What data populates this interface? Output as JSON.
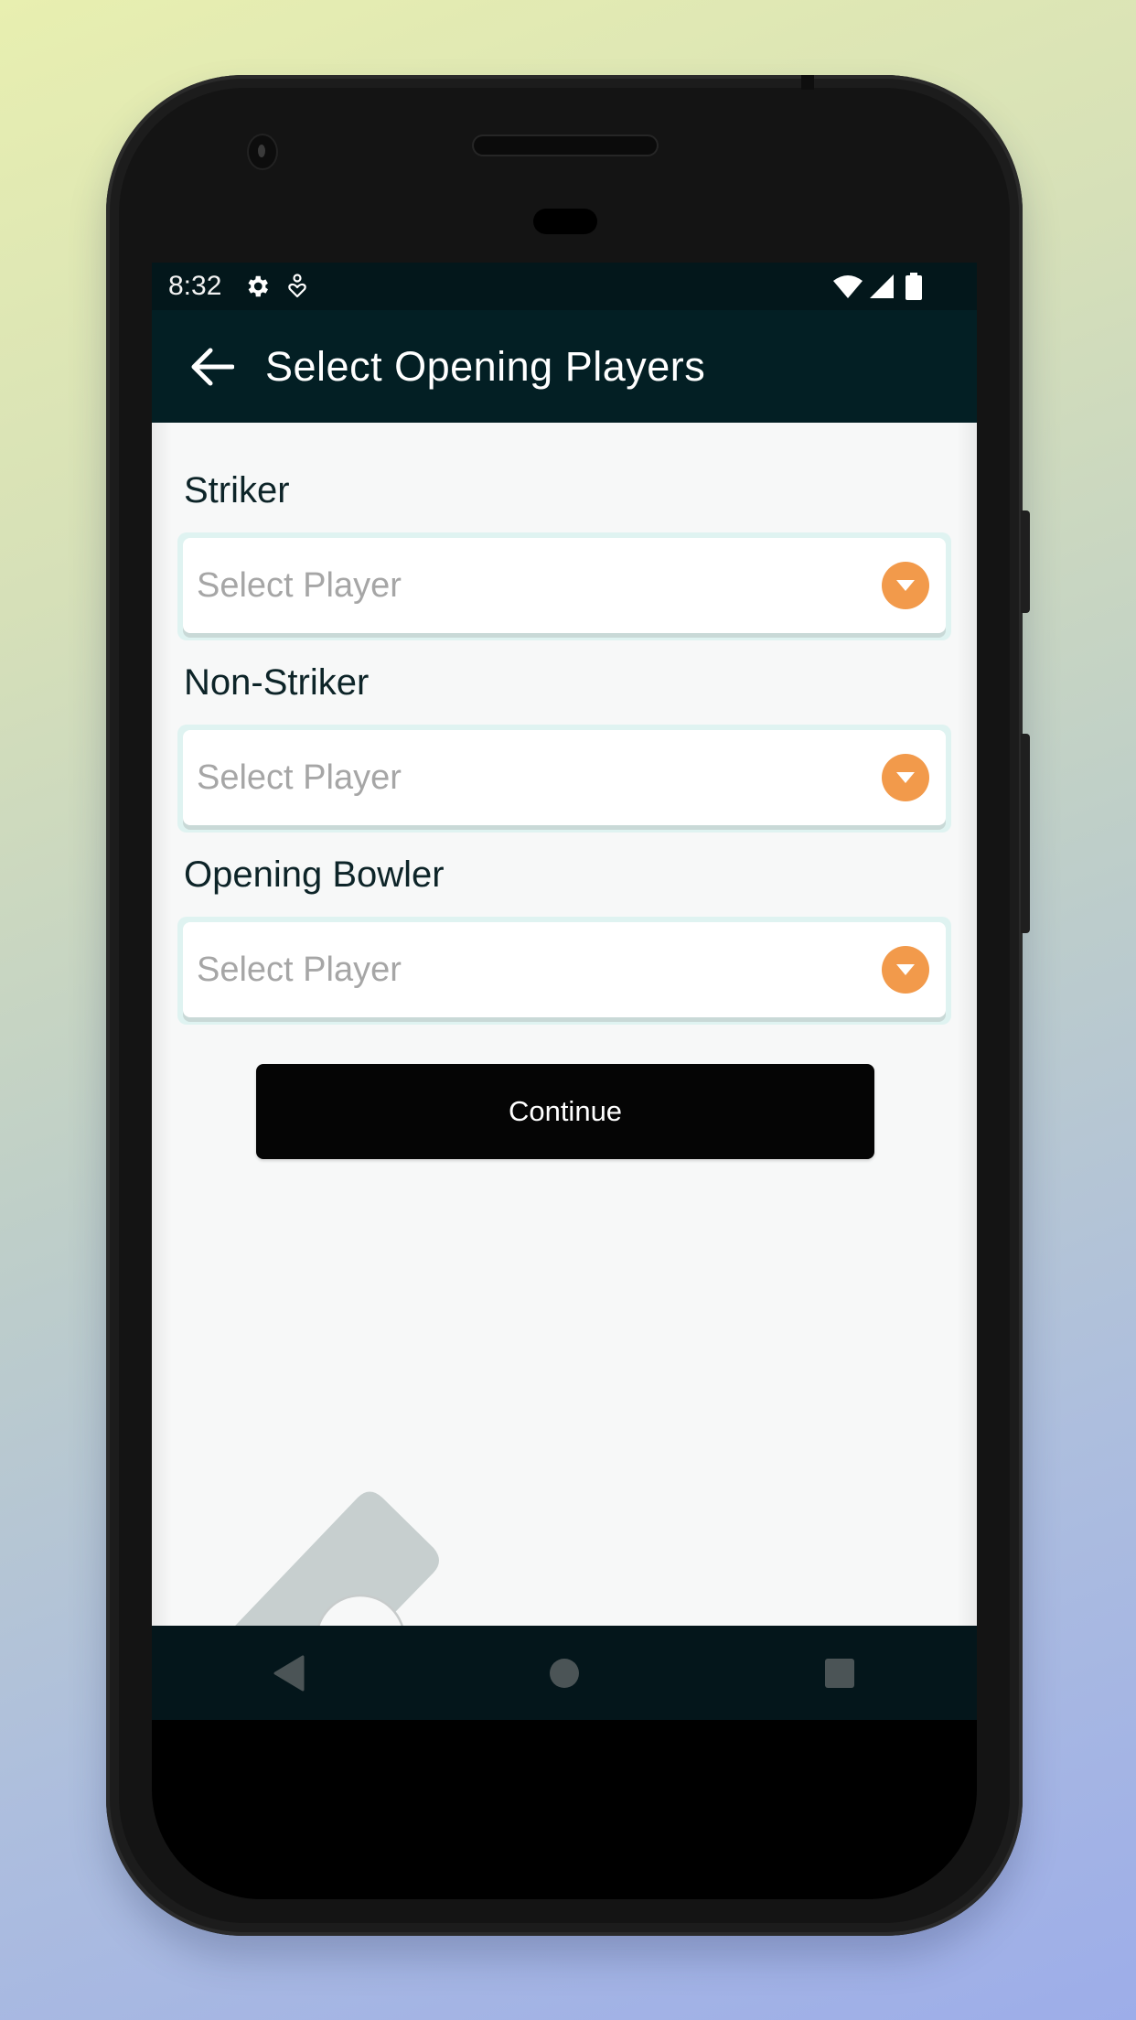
{
  "status_bar": {
    "time": "8:32",
    "left_icons": [
      "gear-icon",
      "accessibility-icon"
    ],
    "right_icons": [
      "wifi-icon",
      "cellular-signal-icon",
      "battery-icon"
    ]
  },
  "app_bar": {
    "back_icon": "arrow-left-icon",
    "title": "Select Opening Players"
  },
  "form": {
    "fields": [
      {
        "label": "Striker",
        "placeholder": "Select Player",
        "value": ""
      },
      {
        "label": "Non-Striker",
        "placeholder": "Select Player",
        "value": ""
      },
      {
        "label": "Opening Bowler",
        "placeholder": "Select Player",
        "value": ""
      }
    ],
    "continue_label": "Continue"
  },
  "nav_bar": {
    "buttons": [
      "back-triangle-icon",
      "home-circle-icon",
      "recents-square-icon"
    ]
  },
  "colors": {
    "app_bar": "#031f24",
    "status_bar": "#03171b",
    "accent": "#f29a4b",
    "button": "#050505",
    "field_border": "#dff3f1",
    "placeholder": "#a6a6a6",
    "illustration": "#c7cfcf"
  }
}
